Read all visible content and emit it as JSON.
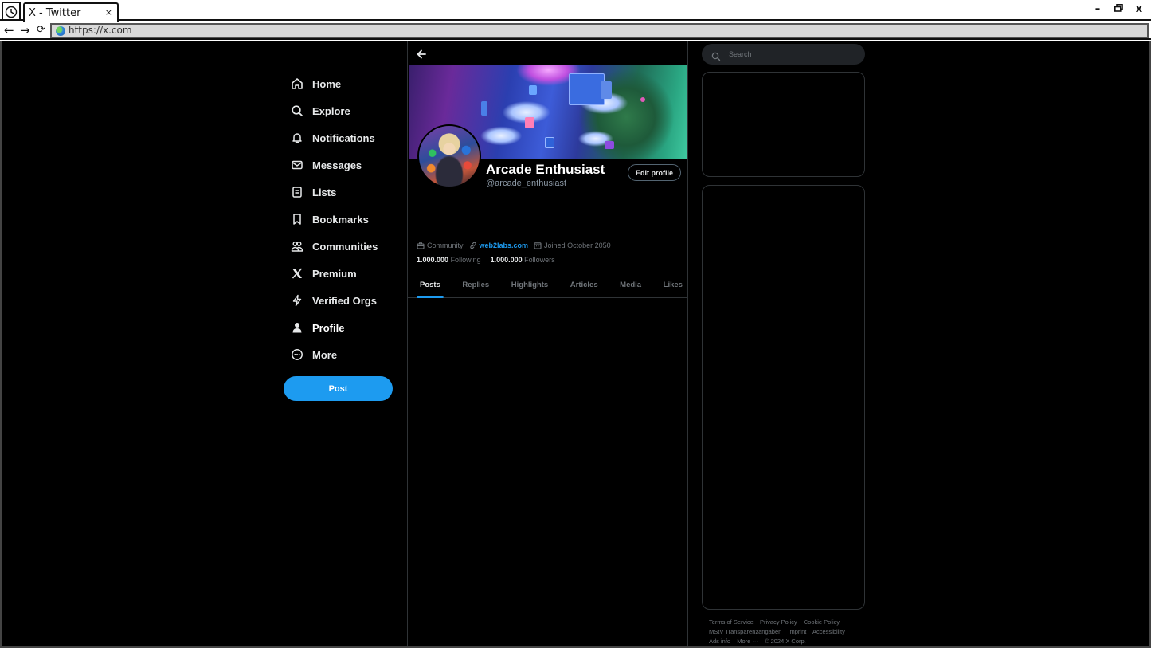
{
  "browser": {
    "tab_title": "X - Twitter",
    "tab_close": "×",
    "url": "https://x.com",
    "back": "←",
    "forward": "→",
    "reload": "⟳",
    "window_controls": {
      "minimize": "–",
      "restore": "🗗",
      "close": "x"
    }
  },
  "sidebar": {
    "items": [
      {
        "label": "Home",
        "icon": "home-icon"
      },
      {
        "label": "Explore",
        "icon": "search-icon"
      },
      {
        "label": "Notifications",
        "icon": "bell-icon"
      },
      {
        "label": "Messages",
        "icon": "envelope-icon"
      },
      {
        "label": "Lists",
        "icon": "list-icon"
      },
      {
        "label": "Bookmarks",
        "icon": "bookmark-icon"
      },
      {
        "label": "Communities",
        "icon": "communities-icon"
      },
      {
        "label": "Premium",
        "icon": "x-logo-icon"
      },
      {
        "label": "Verified Orgs",
        "icon": "lightning-icon"
      },
      {
        "label": "Profile",
        "icon": "person-icon",
        "active": true
      },
      {
        "label": "More",
        "icon": "more-circle-icon"
      }
    ],
    "post_button": "Post"
  },
  "profile": {
    "display_name": "Arcade Enthusiast",
    "handle": "@arcade_enthusiast",
    "edit_button": "Edit profile",
    "category": "Community",
    "website": "web2labs.com",
    "joined": "Joined October 2050",
    "following_count": "1.000.000",
    "following_label": "Following",
    "followers_count": "1.000.000",
    "followers_label": "Followers",
    "tabs": [
      {
        "label": "Posts",
        "active": true
      },
      {
        "label": "Replies"
      },
      {
        "label": "Highlights"
      },
      {
        "label": "Articles"
      },
      {
        "label": "Media"
      },
      {
        "label": "Likes"
      }
    ]
  },
  "right": {
    "search_placeholder": "Search",
    "footer_links": [
      "Terms of Service",
      "Privacy Policy",
      "Cookie Policy",
      "MStV Transparenzangaben",
      "Imprint",
      "Accessibility",
      "Ads info",
      "More ···",
      "© 2024 X Corp."
    ]
  },
  "colors": {
    "accent": "#1d9bf0",
    "background": "#000000",
    "border": "#2f3336",
    "muted_text": "#71767b"
  }
}
